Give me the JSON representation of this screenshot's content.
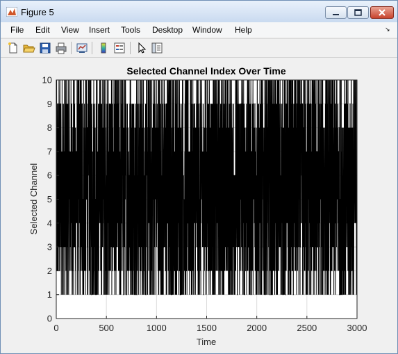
{
  "window": {
    "title": "Figure 5"
  },
  "menu": {
    "items": [
      "File",
      "Edit",
      "View",
      "Insert",
      "Tools",
      "Desktop",
      "Window",
      "Help"
    ]
  },
  "toolbar": {
    "icons": [
      "new-figure-icon",
      "open-file-icon",
      "save-icon",
      "print-icon",
      "link-plot-icon",
      "colorbar-icon",
      "legend-icon",
      "pointer-icon",
      "property-inspector-icon"
    ]
  },
  "chart_data": {
    "type": "line",
    "title": "Selected Channel Index Over Time",
    "xlabel": "Time",
    "ylabel": "Selected Channel",
    "xlim": [
      0,
      3000
    ],
    "ylim": [
      0,
      10
    ],
    "xticks": [
      "0",
      "500",
      "1000",
      "1500",
      "2000",
      "2500",
      "3000"
    ],
    "yticks": [
      "0",
      "1",
      "2",
      "3",
      "4",
      "5",
      "6",
      "7",
      "8",
      "9",
      "10"
    ],
    "grid": true,
    "series_color": "#000000",
    "n_points": 3000,
    "value_range": [
      1,
      10
    ]
  }
}
